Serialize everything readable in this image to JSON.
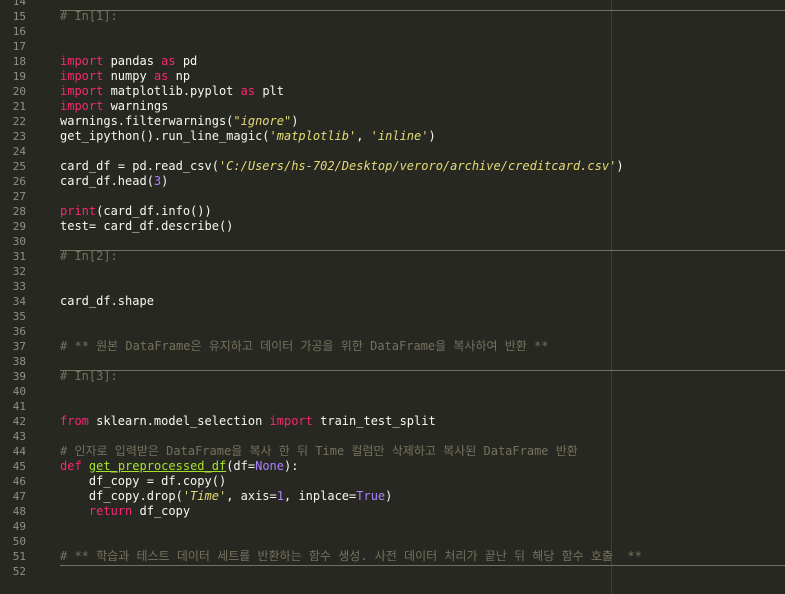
{
  "lines": [
    {
      "n": "14",
      "sep": false,
      "t": []
    },
    {
      "n": "15",
      "sep": true,
      "t": [
        {
          "c": "cm",
          "s": "# In[1]:"
        }
      ]
    },
    {
      "n": "16",
      "sep": false,
      "t": []
    },
    {
      "n": "17",
      "sep": false,
      "t": []
    },
    {
      "n": "18",
      "sep": false,
      "t": [
        {
          "c": "kw",
          "s": "import"
        },
        {
          "c": "pl",
          "s": " pandas "
        },
        {
          "c": "kw",
          "s": "as"
        },
        {
          "c": "pl",
          "s": " pd"
        }
      ]
    },
    {
      "n": "19",
      "sep": false,
      "t": [
        {
          "c": "kw",
          "s": "import"
        },
        {
          "c": "pl",
          "s": " numpy "
        },
        {
          "c": "kw",
          "s": "as"
        },
        {
          "c": "pl",
          "s": " np"
        }
      ]
    },
    {
      "n": "20",
      "sep": false,
      "t": [
        {
          "c": "kw",
          "s": "import"
        },
        {
          "c": "pl",
          "s": " matplotlib.pyplot "
        },
        {
          "c": "kw",
          "s": "as"
        },
        {
          "c": "pl",
          "s": " plt"
        }
      ]
    },
    {
      "n": "21",
      "sep": false,
      "t": [
        {
          "c": "kw",
          "s": "import"
        },
        {
          "c": "pl",
          "s": " warnings"
        }
      ]
    },
    {
      "n": "22",
      "sep": false,
      "t": [
        {
          "c": "pl",
          "s": "warnings.filterwarnings("
        },
        {
          "c": "st",
          "s": "\"ignore\""
        },
        {
          "c": "pl",
          "s": ")"
        }
      ]
    },
    {
      "n": "23",
      "sep": false,
      "t": [
        {
          "c": "pl",
          "s": "get_ipython().run_line_magic("
        },
        {
          "c": "st",
          "s": "'matplotlib'"
        },
        {
          "c": "pl",
          "s": ", "
        },
        {
          "c": "st",
          "s": "'inline'"
        },
        {
          "c": "pl",
          "s": ")"
        }
      ]
    },
    {
      "n": "24",
      "sep": false,
      "t": []
    },
    {
      "n": "25",
      "sep": false,
      "t": [
        {
          "c": "pl",
          "s": "card_df = pd.read_csv("
        },
        {
          "c": "st",
          "s": "'C:/Users/hs-702/Desktop/veroro/archive/creditcard.csv'"
        },
        {
          "c": "pl",
          "s": ")"
        }
      ]
    },
    {
      "n": "26",
      "sep": false,
      "t": [
        {
          "c": "pl",
          "s": "card_df.head("
        },
        {
          "c": "kn",
          "s": "3"
        },
        {
          "c": "pl",
          "s": ")"
        }
      ]
    },
    {
      "n": "27",
      "sep": false,
      "t": []
    },
    {
      "n": "28",
      "sep": false,
      "t": [
        {
          "c": "kw",
          "s": "print"
        },
        {
          "c": "pl",
          "s": "(card_df.info())"
        }
      ]
    },
    {
      "n": "29",
      "sep": false,
      "t": [
        {
          "c": "pl",
          "s": "test= card_df.describe()"
        }
      ]
    },
    {
      "n": "30",
      "sep": false,
      "t": []
    },
    {
      "n": "31",
      "sep": true,
      "t": [
        {
          "c": "cm",
          "s": "# In[2]:"
        }
      ]
    },
    {
      "n": "32",
      "sep": false,
      "t": []
    },
    {
      "n": "33",
      "sep": false,
      "t": []
    },
    {
      "n": "34",
      "sep": false,
      "t": [
        {
          "c": "pl",
          "s": "card_df.shape"
        }
      ]
    },
    {
      "n": "35",
      "sep": false,
      "t": []
    },
    {
      "n": "36",
      "sep": false,
      "t": []
    },
    {
      "n": "37",
      "sep": false,
      "t": [
        {
          "c": "cm",
          "s": "# ** 원본 DataFrame은 유지하고 데이터 가공을 위한 DataFrame을 복사하여 반환 **"
        }
      ]
    },
    {
      "n": "38",
      "sep": false,
      "t": []
    },
    {
      "n": "39",
      "sep": true,
      "t": [
        {
          "c": "cm",
          "s": "# In[3]:"
        }
      ]
    },
    {
      "n": "40",
      "sep": false,
      "t": []
    },
    {
      "n": "41",
      "sep": false,
      "t": []
    },
    {
      "n": "42",
      "sep": false,
      "t": [
        {
          "c": "kw",
          "s": "from"
        },
        {
          "c": "pl",
          "s": " sklearn.model_selection "
        },
        {
          "c": "kw",
          "s": "import"
        },
        {
          "c": "pl",
          "s": " train_test_split"
        }
      ]
    },
    {
      "n": "43",
      "sep": false,
      "t": []
    },
    {
      "n": "44",
      "sep": false,
      "t": [
        {
          "c": "cm",
          "s": "# 인자로 입력받은 DataFrame을 복사 한 뒤 Time 컬럼만 삭제하고 복사된 DataFrame 반환"
        }
      ]
    },
    {
      "n": "45",
      "sep": false,
      "t": [
        {
          "c": "kw",
          "s": "def"
        },
        {
          "c": "pl",
          "s": " "
        },
        {
          "c": "fn",
          "s": "get_preprocessed_df"
        },
        {
          "c": "pl",
          "s": "(df="
        },
        {
          "c": "kn",
          "s": "None"
        },
        {
          "c": "pl",
          "s": "):"
        }
      ]
    },
    {
      "n": "46",
      "sep": false,
      "t": [
        {
          "c": "pl",
          "s": "    df_copy = df.copy()"
        }
      ]
    },
    {
      "n": "47",
      "sep": false,
      "t": [
        {
          "c": "pl",
          "s": "    df_copy.drop("
        },
        {
          "c": "st",
          "s": "'Time'"
        },
        {
          "c": "pl",
          "s": ", axis="
        },
        {
          "c": "kn",
          "s": "1"
        },
        {
          "c": "pl",
          "s": ", inplace="
        },
        {
          "c": "kn",
          "s": "True"
        },
        {
          "c": "pl",
          "s": ")"
        }
      ]
    },
    {
      "n": "48",
      "sep": false,
      "t": [
        {
          "c": "pl",
          "s": "    "
        },
        {
          "c": "kw",
          "s": "return"
        },
        {
          "c": "pl",
          "s": " df_copy"
        }
      ]
    },
    {
      "n": "49",
      "sep": false,
      "t": []
    },
    {
      "n": "50",
      "sep": false,
      "t": []
    },
    {
      "n": "51",
      "sep": false,
      "t": [
        {
          "c": "cm",
          "s": "# ** 학습과 테스트 데이터 세트를 반환하는 함수 생성. 사전 데이터 처리가 끝난 뒤 해당 함수 호출  **"
        }
      ]
    },
    {
      "n": "52",
      "sep": true,
      "t": []
    }
  ]
}
